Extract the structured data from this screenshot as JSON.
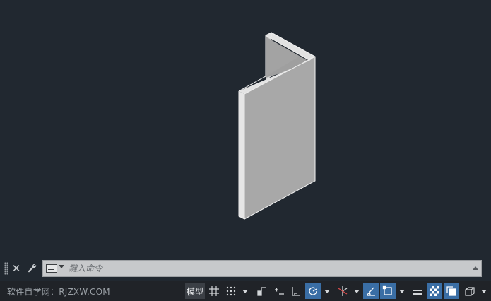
{
  "viewport": {
    "background": "#212830",
    "model": {
      "object": "Z-section solid (isometric view)",
      "face_color": "#a8a8a8"
    }
  },
  "command_line": {
    "close_icon": "close-icon",
    "customize_icon": "wrench-icon",
    "prompt_icon": "command-prompt-icon",
    "placeholder": "鍵入命令"
  },
  "status_bar": {
    "watermark": "软件自学网：RJZXW.COM",
    "model_tab": "模型",
    "tools": [
      {
        "name": "grid-icon",
        "active": false
      },
      {
        "name": "snap-icon",
        "active": false
      },
      {
        "name": "infer-constraints-icon",
        "active": false
      },
      {
        "name": "dynamic-input-icon",
        "active": false
      },
      {
        "name": "ortho-icon",
        "active": false
      },
      {
        "name": "polar-tracking-icon",
        "active": true
      },
      {
        "name": "isodraft-icon",
        "active": false
      },
      {
        "name": "object-snap-tracking-icon",
        "active": true
      },
      {
        "name": "object-snap-icon",
        "active": true
      },
      {
        "name": "lineweight-icon",
        "active": false
      },
      {
        "name": "transparency-icon",
        "active": true
      },
      {
        "name": "selection-cycling-icon",
        "active": true
      },
      {
        "name": "3d-object-snap-icon",
        "active": false
      }
    ],
    "accent": "#3a6ea5"
  }
}
